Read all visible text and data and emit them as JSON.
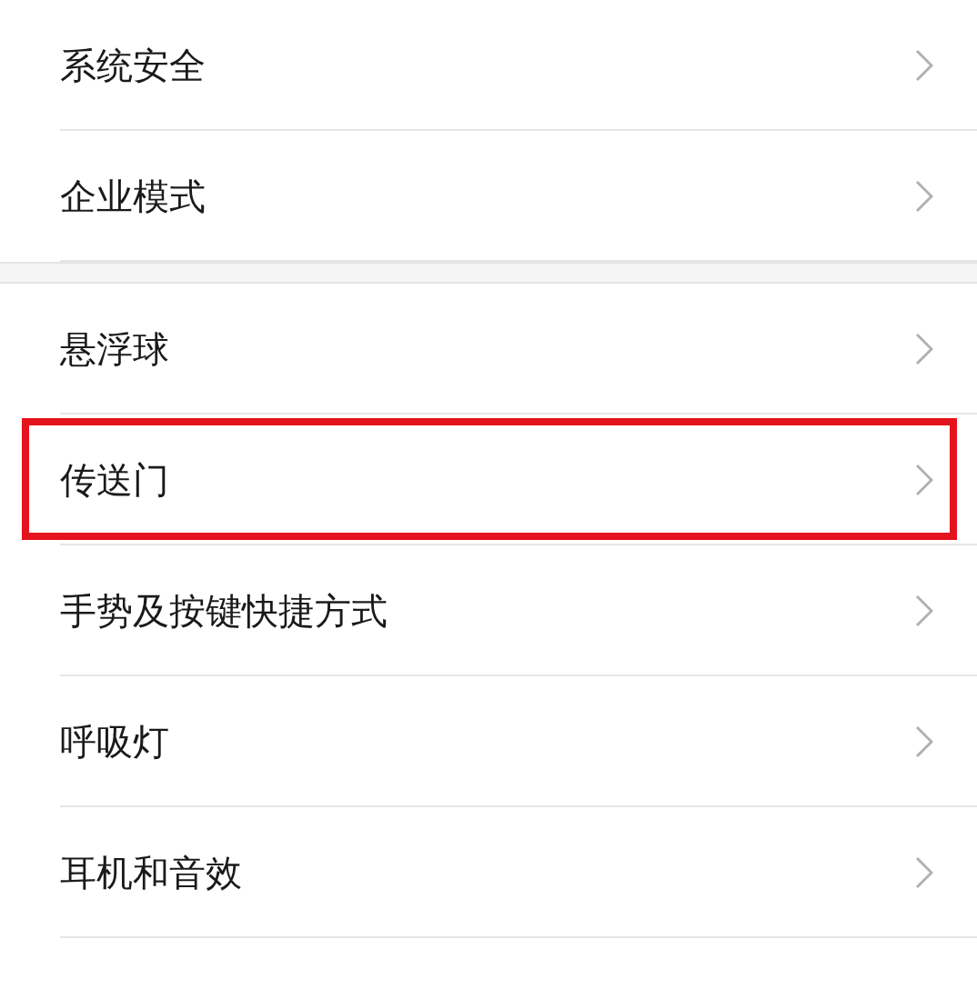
{
  "sections": [
    {
      "items": [
        {
          "label": "系统安全",
          "highlighted": false
        },
        {
          "label": "企业模式",
          "highlighted": false
        }
      ]
    },
    {
      "items": [
        {
          "label": "悬浮球",
          "highlighted": false
        },
        {
          "label": "传送门",
          "highlighted": true
        },
        {
          "label": "手势及按键快捷方式",
          "highlighted": false
        },
        {
          "label": "呼吸灯",
          "highlighted": false
        },
        {
          "label": "耳机和音效",
          "highlighted": false
        }
      ]
    }
  ]
}
